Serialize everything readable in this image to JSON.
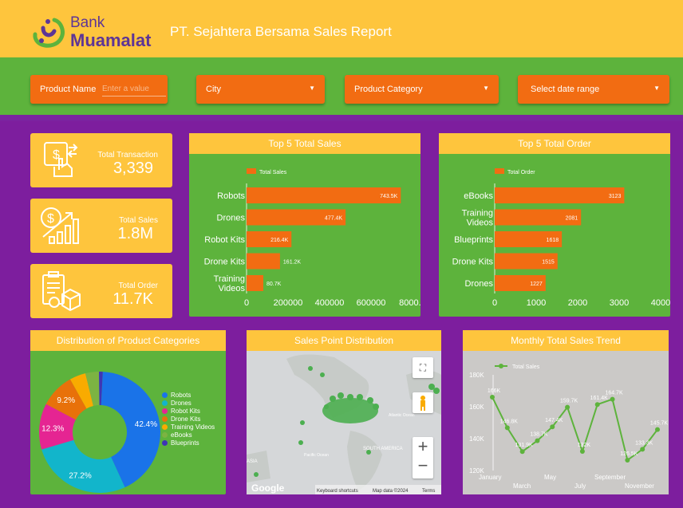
{
  "header": {
    "logo_bank": "Bank",
    "logo_name": "Muamalat",
    "title": "PT. Sejahtera Bersama Sales Report",
    "bg_color": "#fec53d"
  },
  "filters": {
    "product_name_label": "Product Name",
    "product_name_placeholder": "Enter a value",
    "city_label": "City",
    "category_label": "Product Category",
    "date_label": "Select date range",
    "color": "#f26c12"
  },
  "kpis": [
    {
      "label": "Total Transaction",
      "value": "3,339",
      "icon": "hand-card-icon"
    },
    {
      "label": "Total Sales",
      "value": "1.8M",
      "icon": "dollar-growth-icon"
    },
    {
      "label": "Total Order",
      "value": "11.7K",
      "icon": "order-box-icon"
    }
  ],
  "top_sales": {
    "title": "Top 5 Total Sales",
    "legend": "Total Sales",
    "ticks": [
      "0",
      "200000",
      "400000",
      "600000",
      "8000..."
    ]
  },
  "top_order": {
    "title": "Top 5 Total Order",
    "legend": "Total Order",
    "ticks": [
      "0",
      "1000",
      "2000",
      "3000",
      "4000"
    ]
  },
  "pie": {
    "title": "Distribution of Product Categories"
  },
  "map": {
    "title": "Sales Point Distribution",
    "labels": {
      "google": "Google",
      "shortcuts": "Keyboard shortcuts",
      "mapdata": "Map data ©2024",
      "terms": "Terms",
      "south_america": "SOUTH AMERICA",
      "pacific": "Pacific Ocean",
      "atlantic": "Atlantic Ocean",
      "asia": "ASIA"
    }
  },
  "trend": {
    "title": "Monthly Total Sales Trend",
    "legend": "Total Sales",
    "yticks": [
      "180K",
      "160K",
      "140K",
      "120K"
    ],
    "xticks_top": [
      "January",
      "May",
      "September"
    ],
    "xticks_bottom": [
      "March",
      "July",
      "November"
    ]
  },
  "chart_data": [
    {
      "type": "bar",
      "title": "Top 5 Total Sales",
      "categories": [
        "Robots",
        "Drones",
        "Robot Kits",
        "Drone Kits",
        "Training Videos"
      ],
      "values": [
        743500,
        477400,
        216400,
        161200,
        80700
      ],
      "labels": [
        "743.5K",
        "477.4K",
        "216.4K",
        "161.2K",
        "80.7K"
      ],
      "series": [
        {
          "name": "Total Sales"
        }
      ],
      "xlim": [
        0,
        800000
      ],
      "color": "#f26c12"
    },
    {
      "type": "bar",
      "title": "Top 5 Total Order",
      "categories": [
        "eBooks",
        "Training Videos",
        "Blueprints",
        "Drone Kits",
        "Drones"
      ],
      "values": [
        3123,
        2081,
        1618,
        1515,
        1227
      ],
      "series": [
        {
          "name": "Total Order"
        }
      ],
      "xlim": [
        0,
        4000
      ],
      "color": "#f26c12"
    },
    {
      "type": "pie",
      "title": "Distribution of Product Categories",
      "categories": [
        "Robots",
        "Drones",
        "Robot Kits",
        "Drone Kits",
        "Training Videos",
        "eBooks",
        "Blueprints"
      ],
      "values": [
        42.4,
        27.2,
        12.3,
        9.2,
        4.3,
        3.6,
        1.0
      ],
      "labels": [
        "42.4%",
        "27.2%",
        "12.3%",
        "9.2%",
        "",
        "",
        ""
      ],
      "colors": [
        "#1a73e8",
        "#12b5cb",
        "#e52592",
        "#e8710a",
        "#f9ab00",
        "#7cb342",
        "#3f35b5"
      ]
    },
    {
      "type": "line",
      "title": "Monthly Total Sales Trend",
      "x": [
        "January",
        "February",
        "March",
        "April",
        "May",
        "June",
        "July",
        "August",
        "September",
        "October",
        "November",
        "December"
      ],
      "series": [
        {
          "name": "Total Sales",
          "values": [
            166,
            146.8,
            131.9,
            138.7,
            147.4,
            159.7,
            132,
            161.4,
            164.7,
            126.5,
            133.3,
            145.7
          ]
        }
      ],
      "labels": [
        "166K",
        "146.8K",
        "131.9K",
        "138.7K",
        "147.4K",
        "159.7K",
        "132K",
        "161.4K",
        "164.7K",
        "126.5K",
        "133.3K",
        "145.7K"
      ],
      "ylim": [
        120,
        180
      ],
      "color": "#5db33c"
    }
  ]
}
